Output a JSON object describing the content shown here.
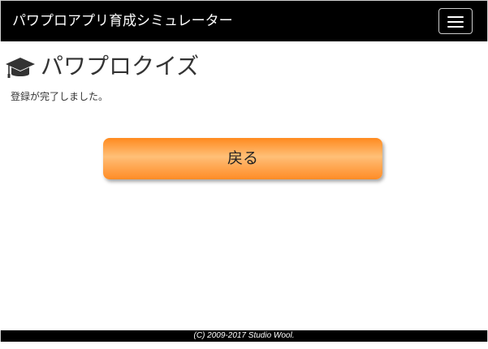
{
  "navbar": {
    "brand": "パワプロアプリ育成シミュレーター",
    "menu_icon": "hamburger-menu-icon"
  },
  "header": {
    "icon": "graduation-cap-icon",
    "title": "パワプロクイズ"
  },
  "main": {
    "message": "登録が完了しました。",
    "back_button_label": "戻る"
  },
  "footer": {
    "copyright": "(C) 2009-2017 Studio Wool."
  },
  "colors": {
    "navbar_bg": "#000000",
    "button_orange": "#ff8a1e",
    "button_highlight": "#ffc078",
    "text": "#333333"
  }
}
